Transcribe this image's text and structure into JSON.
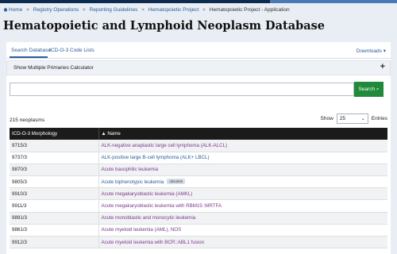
{
  "breadcrumb": {
    "items": [
      "Home",
      "Registry Operations",
      "Reporting Guidelines",
      "Hematopoietic Project",
      "Hematopoietic Project - Application"
    ],
    "separator": ">"
  },
  "page_title": "Hematopoietic and Lymphoid Neoplasm Database",
  "tabs": [
    {
      "label": "Search Database",
      "active": true
    },
    {
      "label": "ICD-O-3 Code Lists",
      "active": false
    }
  ],
  "downloads": {
    "label": "Downloads",
    "icon": "chevron-down-icon"
  },
  "calculator": {
    "label": "Show Multiple Primaries Calculator",
    "icon": "plus-icon"
  },
  "search": {
    "value": "",
    "placeholder": "",
    "button_label": "Search",
    "button_icon": "search-icon"
  },
  "results": {
    "count": "215 neoplasms",
    "show_label": "Show",
    "page_size": "25",
    "entries_label": "Entries"
  },
  "table": {
    "headers": [
      "ICD-O-3 Morphology",
      "▲ Name"
    ],
    "rows": [
      {
        "code": "9715/3",
        "name": "ALK-negative anaplastic large cell lymphoma (ALK-ALCL)",
        "badge": ""
      },
      {
        "code": "9737/3",
        "name": "ALK-positive large B-cell lymphoma (ALK+ LBCL)",
        "badge": ""
      },
      {
        "code": "9870/3",
        "name": "Acute basophilic leukemia",
        "badge": ""
      },
      {
        "code": "9805/3",
        "name": "Acute biphenotypic leukemia",
        "badge": "obsolete"
      },
      {
        "code": "9910/3",
        "name": "Acute megakaryoblastic leukemia (AMKL)",
        "badge": ""
      },
      {
        "code": "9911/3",
        "name": "Acute megakaryoblastic leukemia with RBM15::MRTFA",
        "badge": ""
      },
      {
        "code": "9891/3",
        "name": "Acute monoblastic and monocytic leukemia",
        "badge": ""
      },
      {
        "code": "9861/3",
        "name": "Acute myeloid leukemia (AML), NOS",
        "badge": ""
      },
      {
        "code": "9912/3",
        "name": "Acute myeloid leukemia with BCR::ABL1 fusion",
        "badge": ""
      }
    ]
  },
  "colors": {
    "topbar": "#0d2a4f",
    "link": "#2b5d9b",
    "visited_link": "#7a3a8a",
    "search_button": "#1f8a3a",
    "table_header": "#1b1b1b"
  }
}
